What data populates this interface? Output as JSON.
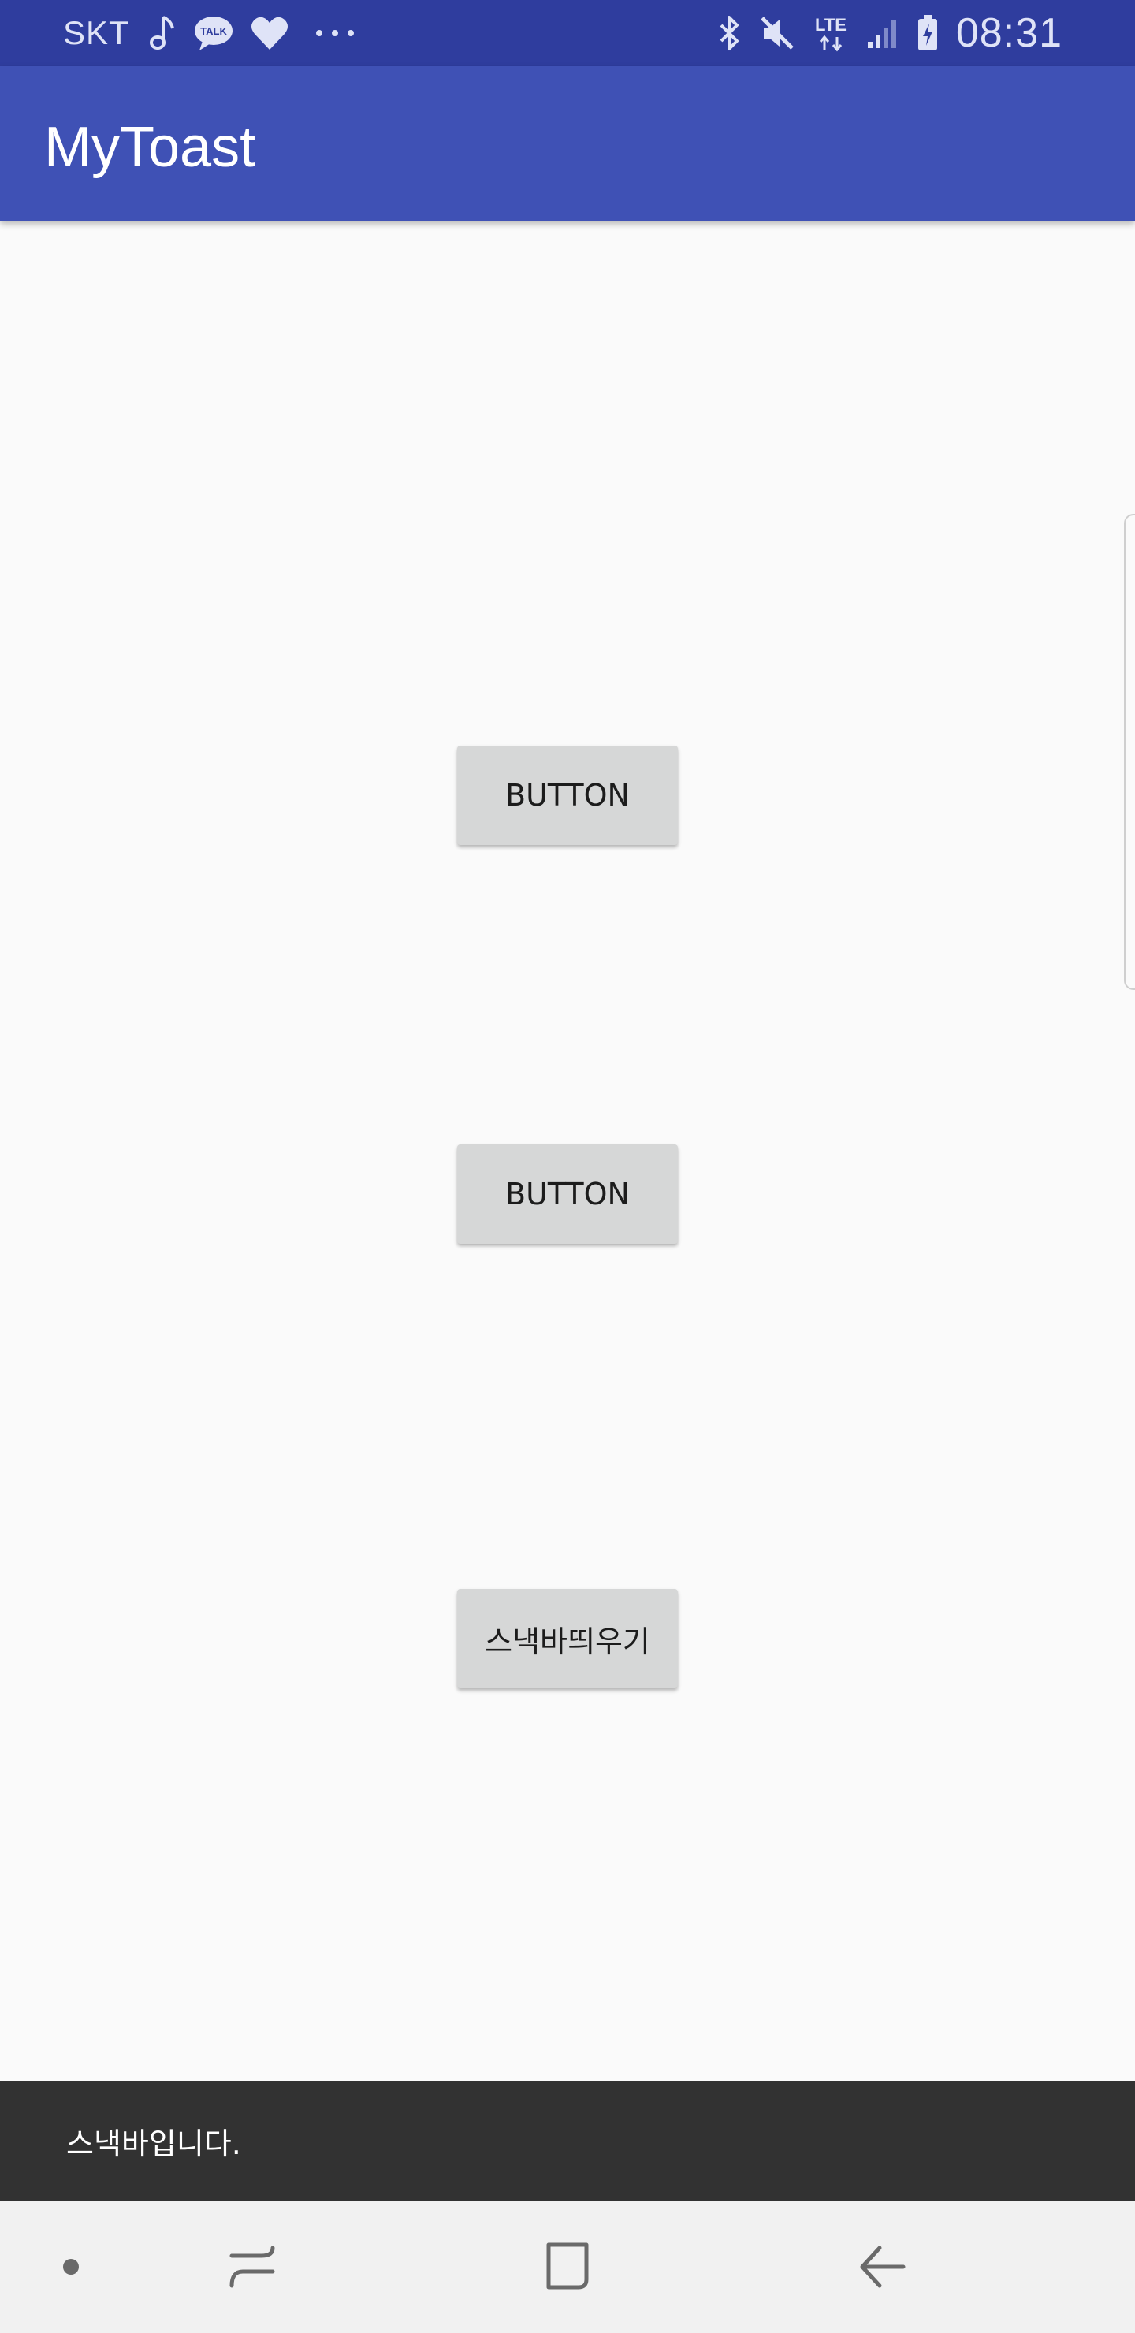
{
  "status_bar": {
    "carrier": "SKT",
    "talk_badge": "TALK",
    "network_type": "LTE",
    "time": "08:31",
    "background_color": "#2f3d9e",
    "icons": {
      "left": [
        "music-note-icon",
        "kakaotalk-icon",
        "heart-icon",
        "more-dots-icon"
      ],
      "right": [
        "bluetooth-icon",
        "mute-icon",
        "lte-icon",
        "signal-icon",
        "battery-charging-icon"
      ]
    }
  },
  "app_bar": {
    "title": "MyToast",
    "background_color": "#3f51b5"
  },
  "main": {
    "buttons": [
      {
        "label": "BUTTON"
      },
      {
        "label": "BUTTON"
      },
      {
        "label": "스낵바띄우기"
      }
    ],
    "button_color": "#d6d7d7"
  },
  "snackbar": {
    "message": "스낵바입니다.",
    "background_color": "#323232"
  },
  "nav_bar": {
    "background_color": "#f1f1f1",
    "items": [
      "dot-indicator-icon",
      "recents-icon",
      "home-icon",
      "back-icon"
    ]
  }
}
